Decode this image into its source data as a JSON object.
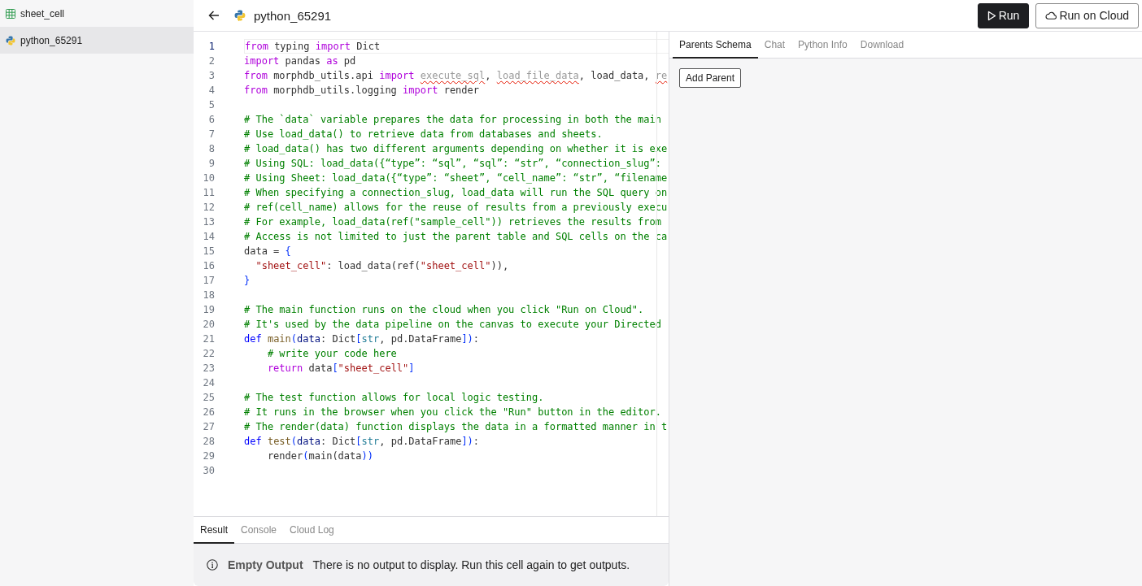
{
  "sidebar": {
    "items": [
      {
        "name": "sheet_cell",
        "kind": "sheet",
        "selected": false
      },
      {
        "name": "python_65291",
        "kind": "python",
        "selected": true
      }
    ]
  },
  "header": {
    "title": "python_65291",
    "buttons": [
      {
        "label": "Run",
        "kind": "run"
      },
      {
        "label": "Run on Cloud",
        "kind": "cloud"
      }
    ]
  },
  "editor": {
    "lines": [
      {
        "number": "1",
        "current": true,
        "tokens": [
          {
            "kind": "keyword",
            "text": "from"
          },
          {
            "kind": "plain",
            "text": " typing "
          },
          {
            "kind": "keyword",
            "text": "import"
          },
          {
            "kind": "plain",
            "text": " Dict"
          }
        ]
      },
      {
        "number": "2",
        "current": false,
        "tokens": [
          {
            "kind": "keyword",
            "text": "import"
          },
          {
            "kind": "plain",
            "text": " pandas "
          },
          {
            "kind": "keyword",
            "text": "as"
          },
          {
            "kind": "plain",
            "text": " pd"
          }
        ]
      },
      {
        "number": "3",
        "current": false,
        "tokens": [
          {
            "kind": "keyword",
            "text": "from"
          },
          {
            "kind": "plain",
            "text": " morphdb_utils.api "
          },
          {
            "kind": "keyword",
            "text": "import "
          },
          {
            "kind": "unused",
            "text": "execute_sql"
          },
          {
            "kind": "plain",
            "text": ", "
          },
          {
            "kind": "unused",
            "text": "load_file_data"
          },
          {
            "kind": "plain",
            "text": ", load_data, "
          },
          {
            "kind": "unused",
            "text": "re"
          }
        ]
      },
      {
        "number": "4",
        "current": false,
        "tokens": [
          {
            "kind": "keyword",
            "text": "from"
          },
          {
            "kind": "plain",
            "text": " morphdb_utils.logging "
          },
          {
            "kind": "keyword",
            "text": "import"
          },
          {
            "kind": "plain",
            "text": " render"
          }
        ]
      },
      {
        "number": "5",
        "current": false
      },
      {
        "number": "6",
        "current": false,
        "tokens": [
          {
            "kind": "comment",
            "text": "# The `data` variable prepares the data for processing in both the main"
          }
        ]
      },
      {
        "number": "7",
        "current": false,
        "tokens": [
          {
            "kind": "comment",
            "text": "# Use load_data() to retrieve data from databases and sheets."
          }
        ]
      },
      {
        "number": "8",
        "current": false,
        "tokens": [
          {
            "kind": "comment",
            "text": "# load_data() has two different arguments depending on whether it is exe"
          }
        ]
      },
      {
        "number": "9",
        "current": false,
        "tokens": [
          {
            "kind": "comment",
            "text": "# Using SQL: load_data({“type”: “sql”, “sql”: “str”, “connection_slug”:"
          }
        ]
      },
      {
        "number": "10",
        "current": false,
        "tokens": [
          {
            "kind": "comment",
            "text": "# Using Sheet: load_data({“type”: “sheet”, “cell_name”: “str”, “filename"
          }
        ]
      },
      {
        "number": "11",
        "current": false,
        "tokens": [
          {
            "kind": "comment",
            "text": "# When specifying a connection_slug, load_data will run the SQL query on"
          }
        ]
      },
      {
        "number": "12",
        "current": false,
        "tokens": [
          {
            "kind": "comment",
            "text": "# ref(cell_name) allows for the reuse of results from a previously execu"
          }
        ]
      },
      {
        "number": "13",
        "current": false,
        "tokens": [
          {
            "kind": "comment",
            "text": "# For example, load_data(ref(\"sample_cell\")) retrieves the results from"
          }
        ]
      },
      {
        "number": "14",
        "current": false,
        "tokens": [
          {
            "kind": "comment",
            "text": "# Access is not limited to just the parent table and SQL cells on the ca"
          }
        ]
      },
      {
        "number": "15",
        "current": false,
        "tokens": [
          {
            "kind": "plain",
            "text": "data = "
          },
          {
            "kind": "bracket",
            "text": "{"
          }
        ]
      },
      {
        "number": "16",
        "current": false,
        "tokens": [
          {
            "kind": "string",
            "text": "  \"sheet_cell\""
          },
          {
            "kind": "plain",
            "text": ": load_data(ref("
          },
          {
            "kind": "string",
            "text": "\"sheet_cell\""
          },
          {
            "kind": "plain",
            "text": ")),"
          }
        ]
      },
      {
        "number": "17",
        "current": false,
        "tokens": [
          {
            "kind": "bracket",
            "text": "}"
          }
        ]
      },
      {
        "number": "18",
        "current": false
      },
      {
        "number": "19",
        "current": false,
        "tokens": [
          {
            "kind": "comment",
            "text": "# The main function runs on the cloud when you click \"Run on Cloud\"."
          }
        ]
      },
      {
        "number": "20",
        "current": false,
        "tokens": [
          {
            "kind": "comment",
            "text": "# It's used by the data pipeline on the canvas to execute your Directed"
          }
        ]
      },
      {
        "number": "21",
        "current": false,
        "tokens": [
          {
            "kind": "def",
            "text": "def "
          },
          {
            "kind": "function",
            "text": "main"
          },
          {
            "kind": "bracket",
            "text": "("
          },
          {
            "kind": "parameter",
            "text": "data"
          },
          {
            "kind": "plain",
            "text": ": Dict"
          },
          {
            "kind": "bracket",
            "text": "["
          },
          {
            "kind": "type",
            "text": "str"
          },
          {
            "kind": "plain",
            "text": ", pd.DataFrame"
          },
          {
            "kind": "bracket",
            "text": "])"
          },
          {
            "kind": "plain",
            "text": ":"
          }
        ]
      },
      {
        "number": "22",
        "current": false,
        "tokens": [
          {
            "kind": "comment",
            "text": "    # write your code here"
          }
        ]
      },
      {
        "number": "23",
        "current": false,
        "tokens": [
          {
            "kind": "keyword",
            "text": "    return"
          },
          {
            "kind": "plain",
            "text": " data"
          },
          {
            "kind": "bracket",
            "text": "["
          },
          {
            "kind": "string",
            "text": "\"sheet_cell\""
          },
          {
            "kind": "bracket",
            "text": "]"
          }
        ]
      },
      {
        "number": "24",
        "current": false
      },
      {
        "number": "25",
        "current": false,
        "tokens": [
          {
            "kind": "comment",
            "text": "# The test function allows for local logic testing."
          }
        ]
      },
      {
        "number": "26",
        "current": false,
        "tokens": [
          {
            "kind": "comment",
            "text": "# It runs in the browser when you click the \"Run\" button in the editor."
          }
        ]
      },
      {
        "number": "27",
        "current": false,
        "tokens": [
          {
            "kind": "comment",
            "text": "# The render(data) function displays the data in a formatted manner in t"
          }
        ]
      },
      {
        "number": "28",
        "current": false,
        "tokens": [
          {
            "kind": "def",
            "text": "def "
          },
          {
            "kind": "function",
            "text": "test"
          },
          {
            "kind": "bracket",
            "text": "("
          },
          {
            "kind": "parameter",
            "text": "data"
          },
          {
            "kind": "plain",
            "text": ": Dict"
          },
          {
            "kind": "bracket",
            "text": "["
          },
          {
            "kind": "type",
            "text": "str"
          },
          {
            "kind": "plain",
            "text": ", pd.DataFrame"
          },
          {
            "kind": "bracket",
            "text": "])"
          },
          {
            "kind": "plain",
            "text": ":"
          }
        ]
      },
      {
        "number": "29",
        "current": false,
        "tokens": [
          {
            "kind": "plain",
            "text": "    render"
          },
          {
            "kind": "bracket",
            "text": "("
          },
          {
            "kind": "plain",
            "text": "main(data"
          },
          {
            "kind": "bracket",
            "text": "))"
          }
        ]
      },
      {
        "number": "30",
        "current": false
      }
    ]
  },
  "output": {
    "tabs": [
      {
        "label": "Result",
        "selected": true
      },
      {
        "label": "Console",
        "selected": false
      },
      {
        "label": "Cloud Log",
        "selected": false
      }
    ],
    "title": "Empty Output",
    "message": "There is no output to display. Run this cell again to get outputs."
  },
  "side_panel": {
    "tabs": [
      {
        "label": "Parents Schema",
        "selected": true
      },
      {
        "label": "Chat",
        "selected": false
      },
      {
        "label": "Python Info",
        "selected": false
      },
      {
        "label": "Download",
        "selected": false
      }
    ],
    "button": "Add Parent"
  }
}
